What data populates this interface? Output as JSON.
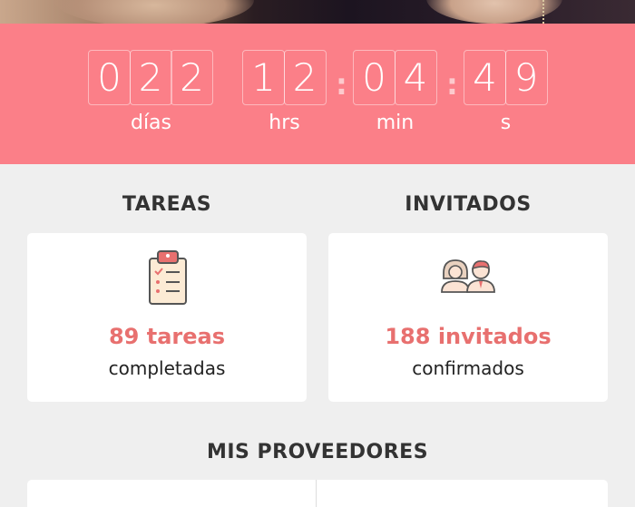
{
  "countdown": {
    "days": [
      "0",
      "2",
      "2"
    ],
    "hours": [
      "1",
      "2"
    ],
    "minutes": [
      "0",
      "4"
    ],
    "seconds": [
      "4",
      "9"
    ],
    "separator": ":",
    "labels": {
      "days": "días",
      "hours": "hrs",
      "minutes": "min",
      "seconds": "s"
    }
  },
  "tasks": {
    "title": "TAREAS",
    "count": "89 tareas",
    "status": "completadas",
    "icon": "clipboard-checklist-icon"
  },
  "guests": {
    "title": "INVITADOS",
    "count": "188 invitados",
    "status": "confirmados",
    "icon": "couple-guests-icon"
  },
  "providers": {
    "title": "MIS PROVEEDORES"
  },
  "colors": {
    "accent": "#fb7f88",
    "count_text": "#e8706f",
    "background": "#efefef"
  }
}
